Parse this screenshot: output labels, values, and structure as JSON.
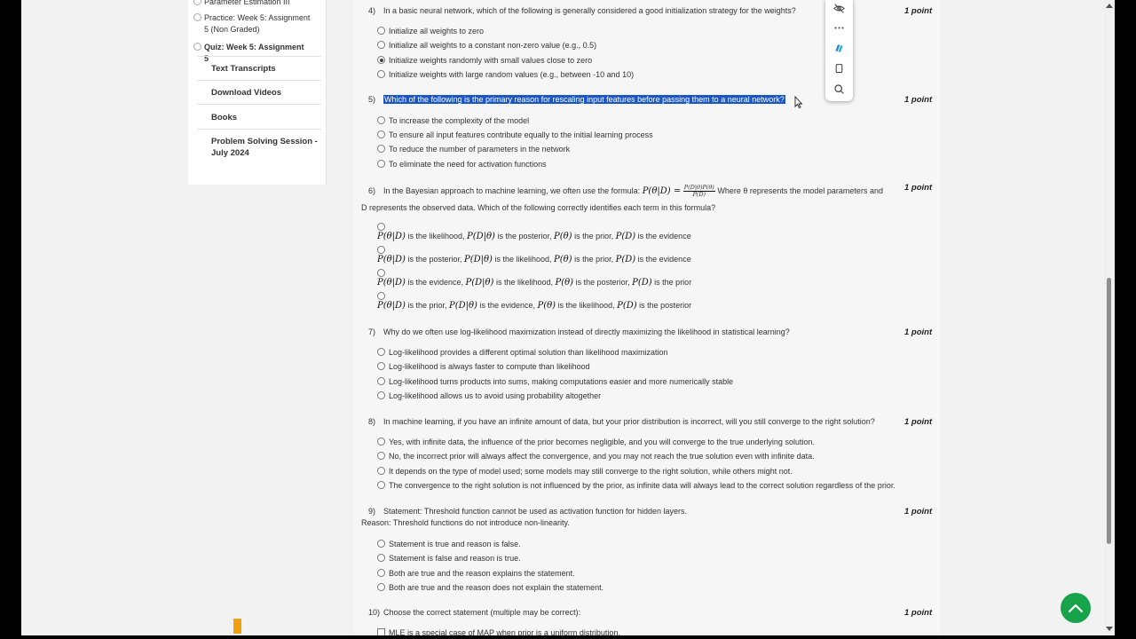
{
  "sidebar": {
    "sub_items": [
      {
        "label": "Parameter Estimation III"
      },
      {
        "label": "Practice: Week 5: Assignment 5 (Non Graded)"
      },
      {
        "label": "Quiz: Week 5: Assignment 5"
      }
    ],
    "items": [
      {
        "label": "Text Transcripts"
      },
      {
        "label": "Download Videos"
      },
      {
        "label": "Books"
      },
      {
        "label": "Problem Solving Session - July 2024"
      }
    ]
  },
  "questions": [
    {
      "number": "4)",
      "text": "In a basic neural network, which of the following is generally considered a good initialization strategy for the weights?",
      "points": "1 point",
      "options": [
        {
          "label": "Initialize all weights to zero",
          "checked": false
        },
        {
          "label": "Initialize all weights to a constant non-zero value (e.g., 0.5)",
          "checked": false
        },
        {
          "label": "Initialize weights randomly with small values close to zero",
          "checked": true
        },
        {
          "label": "Initialize weights with large random values (e.g., between -10 and 10)",
          "checked": false
        }
      ]
    },
    {
      "number": "5)",
      "text": "Which of the following is the primary reason for rescaling input features before passing them to a neural network?",
      "points": "1 point",
      "options": [
        {
          "label": "To increase the complexity of the model"
        },
        {
          "label": "To ensure all input features contribute equally to the initial learning process"
        },
        {
          "label": "To reduce the number of parameters in the network"
        },
        {
          "label": "To eliminate the need for activation functions"
        }
      ]
    },
    {
      "number": "6)",
      "text_before": "In the Bayesian approach to machine learning, we often use the formula:",
      "formula_lhs": "P(θ|D) =",
      "formula_num": "P(D|θ)P(θ)",
      "formula_den": "P(D)",
      "text_after": "Where θ represents the model parameters and",
      "text_line2": "D represents the observed data. Which of the following correctly identifies each term in this formula?",
      "points": "1 point",
      "options": [
        {
          "t1": "P(θ|D)",
          "w1": " is the likelihood, ",
          "t2": "P(D|θ)",
          "w2": " is the posterior, ",
          "t3": "P(θ)",
          "w3": " is the prior, ",
          "t4": "P(D)",
          "w4": " is the evidence"
        },
        {
          "t1": "P(θ|D)",
          "w1": " is the posterior, ",
          "t2": "P(D|θ)",
          "w2": " is the likelihood, ",
          "t3": "P(θ)",
          "w3": " is the prior, ",
          "t4": "P(D)",
          "w4": " is the evidence"
        },
        {
          "t1": "P(θ|D)",
          "w1": " is the evidence, ",
          "t2": "P(D|θ)",
          "w2": " is the likelihood, ",
          "t3": "P(θ)",
          "w3": " is the posterior, ",
          "t4": "P(D)",
          "w4": " is the prior"
        },
        {
          "t1": "P(θ|D)",
          "w1": " is the prior, ",
          "t2": "P(D|θ)",
          "w2": " is the evidence, ",
          "t3": "P(θ)",
          "w3": " is the likelihood, ",
          "t4": "P(D)",
          "w4": " is the posterior"
        }
      ]
    },
    {
      "number": "7)",
      "text": "Why do we often use log-likelihood maximization instead of directly maximizing the likelihood in statistical learning?",
      "points": "1 point",
      "options": [
        {
          "label": "Log-likelihood provides a different optimal solution than likelihood maximization"
        },
        {
          "label": "Log-likelihood is always faster to compute than likelihood"
        },
        {
          "label": "Log-likelihood turns products into sums, making computations easier and more numerically stable"
        },
        {
          "label": "Log-likelihood allows us to avoid using probability altogether"
        }
      ]
    },
    {
      "number": "8)",
      "text": "In machine learning, if you have an infinite amount of data, but your prior distribution is incorrect, will you still converge to the right solution?",
      "points": "1 point",
      "options": [
        {
          "label": "Yes, with infinite data, the influence of the prior becomes negligible, and you will converge to the true underlying solution."
        },
        {
          "label": "No, the incorrect prior will always affect the convergence, and you may not reach the true solution even with infinite data."
        },
        {
          "label": "It depends on the type of model used; some models may still converge to the right solution, while others might not."
        },
        {
          "label": "The convergence to the right solution is not influenced by the prior, as infinite data will always lead to the correct solution regardless of the prior."
        }
      ]
    },
    {
      "number": "9)",
      "text": "Statement: Threshold function cannot be used as activation function for hidden layers.",
      "text_line2": "Reason: Threshold functions do not introduce non-linearity.",
      "points": "1 point",
      "options": [
        {
          "label": "Statement is true and reason is false."
        },
        {
          "label": "Statement is false and reason is true."
        },
        {
          "label": "Both are true and the reason explains the statement."
        },
        {
          "label": "Both are true and the reason does not explain the statement."
        }
      ]
    },
    {
      "number": "10)",
      "text": "Choose the correct statement (multiple may be correct):",
      "points": "1 point",
      "options": [
        {
          "label": "MLE is a special case of MAP when prior is a uniform distribution."
        }
      ]
    }
  ],
  "toolbar": {
    "icons": [
      "visibility-off-icon",
      "more-options-icon",
      "copilot-icon",
      "copy-icon",
      "search-icon"
    ]
  },
  "colors": {
    "selection": "#1a57c4",
    "scroll_top_button": "#16a34a",
    "marker": "#f0a010"
  }
}
